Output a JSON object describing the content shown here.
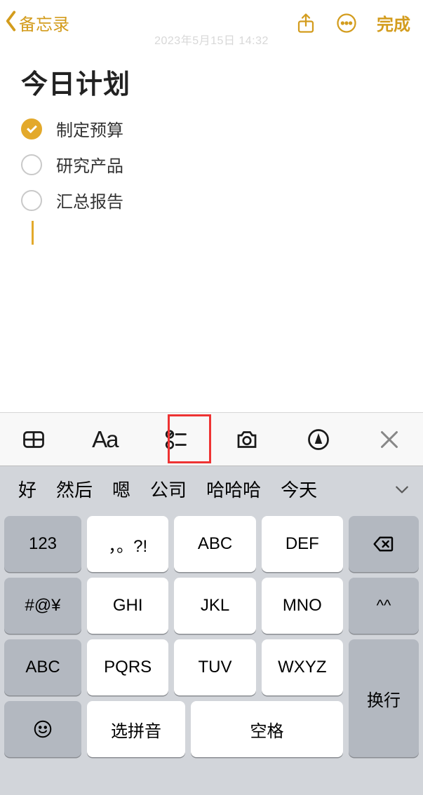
{
  "nav": {
    "back_label": "备忘录",
    "timestamp": "2023年5月15日 14:32",
    "done_label": "完成"
  },
  "note": {
    "title": "今日计划",
    "items": [
      {
        "label": "制定预算",
        "checked": true
      },
      {
        "label": "研究产品",
        "checked": false
      },
      {
        "label": "汇总报告",
        "checked": false
      }
    ]
  },
  "toolbar": {
    "aa_label": "Aa"
  },
  "candidates": [
    "好",
    "然后",
    "嗯",
    "公司",
    "哈哈哈",
    "今天"
  ],
  "keyboard": {
    "fn_rows": [
      "123",
      "#@¥",
      "ABC"
    ],
    "main_rows": [
      [
        "，。?!",
        "ABC",
        "DEF"
      ],
      [
        "GHI",
        "JKL",
        "MNO"
      ],
      [
        "PQRS",
        "TUV",
        "WXYZ"
      ]
    ],
    "face_label": "^^",
    "return_label": "换行",
    "select_pinyin": "选拼音",
    "space_label": "空格",
    "emoji": "☺"
  }
}
